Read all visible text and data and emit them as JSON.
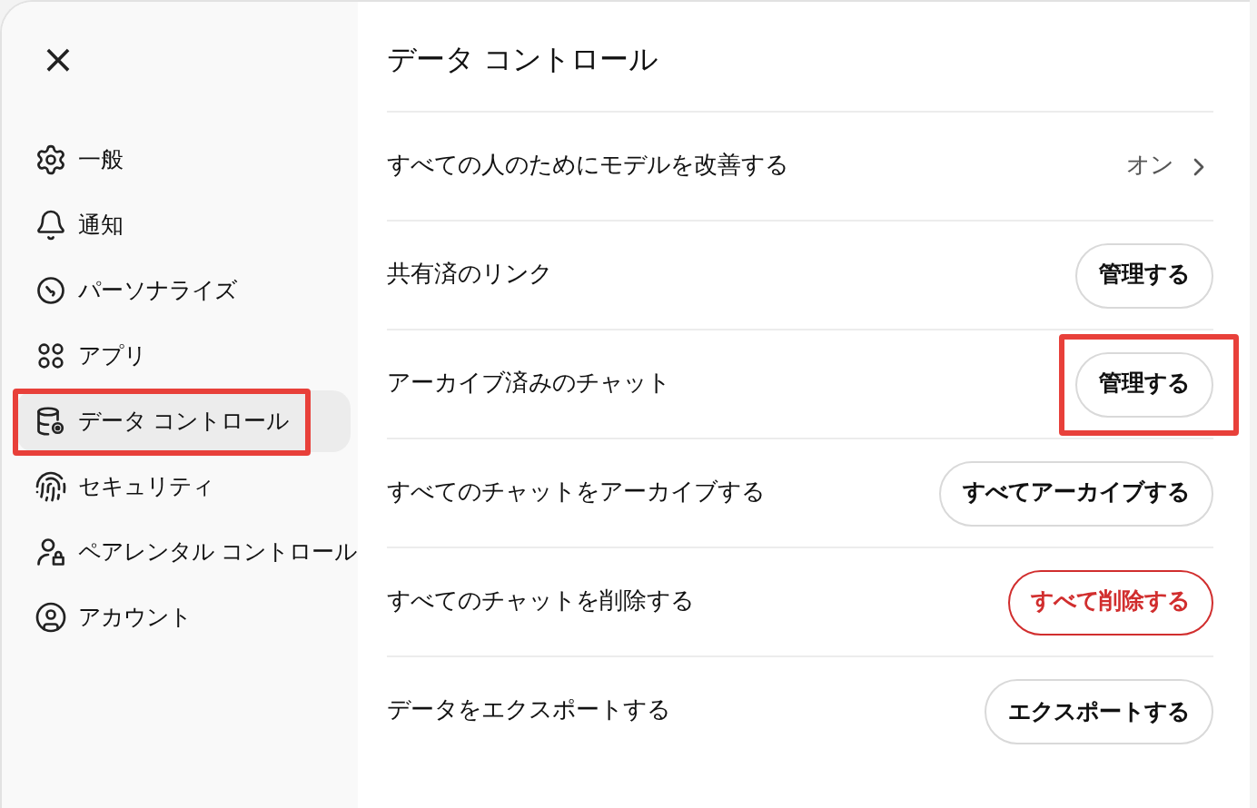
{
  "sidebar": {
    "close": "×",
    "items": [
      {
        "label": "一般",
        "selected": false,
        "highlighted": false
      },
      {
        "label": "通知",
        "selected": false,
        "highlighted": false
      },
      {
        "label": "パーソナライズ",
        "selected": false,
        "highlighted": false
      },
      {
        "label": "アプリ",
        "selected": false,
        "highlighted": false
      },
      {
        "label": "データ コントロール",
        "selected": true,
        "highlighted": true
      },
      {
        "label": "セキュリティ",
        "selected": false,
        "highlighted": false
      },
      {
        "label": "ペアレンタル コントロール",
        "selected": false,
        "highlighted": false
      },
      {
        "label": "アカウント",
        "selected": false,
        "highlighted": false
      }
    ]
  },
  "panel": {
    "title": "データ コントロール",
    "rows": [
      {
        "label": "すべての人のためにモデルを改善する",
        "kind": "link",
        "value": "オン"
      },
      {
        "label": "共有済のリンク",
        "kind": "button",
        "button": "管理する",
        "danger": false,
        "highlighted": false
      },
      {
        "label": "アーカイブ済みのチャット",
        "kind": "button",
        "button": "管理する",
        "danger": false,
        "highlighted": true
      },
      {
        "label": "すべてのチャットをアーカイブする",
        "kind": "button",
        "button": "すべてアーカイブする",
        "danger": false,
        "highlighted": false
      },
      {
        "label": "すべてのチャットを削除する",
        "kind": "button",
        "button": "すべて削除する",
        "danger": true,
        "highlighted": false
      },
      {
        "label": "データをエクスポートする",
        "kind": "button",
        "button": "エクスポートする",
        "danger": false,
        "highlighted": false
      }
    ]
  }
}
